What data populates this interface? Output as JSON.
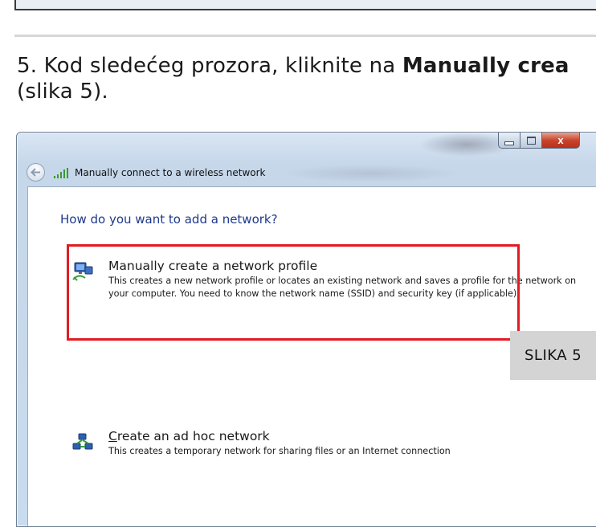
{
  "instruction": {
    "prefix": "5. Kod sledećeg prozora, kliknite na ",
    "bold": "Manually crea",
    "line2": "(slika 5)."
  },
  "window": {
    "back_icon": "back-arrow-icon",
    "title_icon": "wireless-signal-icon",
    "title": "Manually connect to a wireless network",
    "caption": {
      "minimize_icon": "minimize-icon",
      "maximize_icon": "maximize-icon",
      "close_icon": "close-icon",
      "close_glyph": "x"
    },
    "heading": "How do you want to add a network?",
    "options": [
      {
        "icon": "network-profile-icon",
        "title": "Manually create a network profile",
        "description": "This creates a new network profile or locates an existing network and saves a profile for the network on your computer. You need to know the network name (SSID) and security key (if applicable)."
      },
      {
        "icon": "ad-hoc-network-icon",
        "title_first": "C",
        "title_rest": "reate an ad hoc network",
        "description": "This creates a temporary network for sharing files or an Internet connection"
      }
    ]
  },
  "badge": {
    "label": "SLIKA 5"
  },
  "colors": {
    "highlight": "#e21b23",
    "heading": "#1e3a8a",
    "badge_bg": "#d4d4d4"
  }
}
